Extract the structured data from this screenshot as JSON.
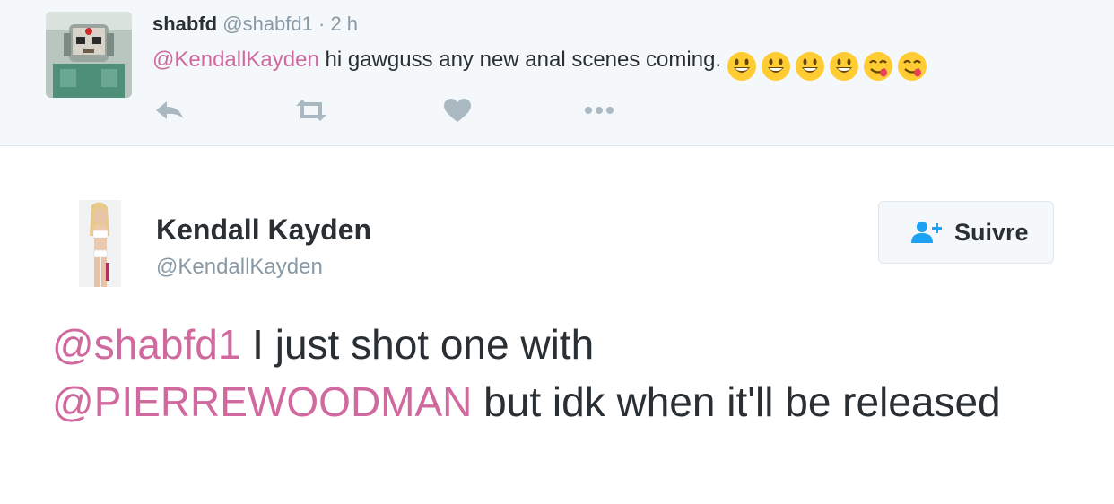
{
  "parent_tweet": {
    "name": "shabfd",
    "handle": "@shabfd1",
    "separator": "·",
    "time": "2 h",
    "mention": "@KendallKayden",
    "text": " hi gawguss any new anal scenes coming.",
    "emojis": [
      "smiley-emoji",
      "smiley-emoji",
      "smiley-emoji",
      "smiley-emoji",
      "savoring-food-emoji",
      "savoring-food-emoji"
    ],
    "actions": [
      "reply-icon",
      "retweet-icon",
      "heart-icon",
      "more-icon"
    ]
  },
  "tweet": {
    "author_name": "Kendall Kayden",
    "author_handle": "@KendallKayden",
    "follow_label": "Suivre",
    "follow_icon": "add-user-icon",
    "mention1": "@shabfd1",
    "text1": " I just shot one with",
    "mention2": "@PIERREWOODMAN",
    "text2": " but idk when it'll be released"
  },
  "colors": {
    "mention": "#d0699e",
    "text": "#292f33",
    "muted": "#8899a6",
    "action_icon": "#aab8c2",
    "follow_icon": "#1da1f2",
    "emoji_yellow": "#ffcc33"
  }
}
